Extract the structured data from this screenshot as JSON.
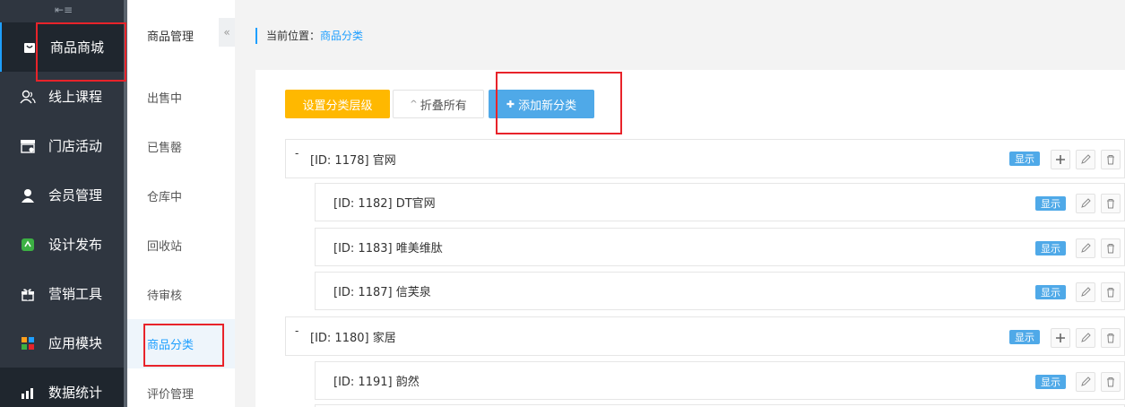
{
  "nav": {
    "collapse_glyph": "⇤≡",
    "items": [
      {
        "label": "商品商城",
        "icon": "bag-icon"
      },
      {
        "label": "线上课程",
        "icon": "user-group-icon"
      },
      {
        "label": "门店活动",
        "icon": "store-icon"
      },
      {
        "label": "会员管理",
        "icon": "user-icon"
      },
      {
        "label": "设计发布",
        "icon": "design-icon"
      },
      {
        "label": "营销工具",
        "icon": "gift-icon"
      },
      {
        "label": "应用模块",
        "icon": "apps-icon"
      },
      {
        "label": "数据统计",
        "icon": "stats-icon"
      }
    ]
  },
  "submenu": {
    "title": "商品管理",
    "items": [
      "出售中",
      "已售罄",
      "仓库中",
      "回收站",
      "待审核",
      "商品分类",
      "评价管理"
    ],
    "toggle_glyph": "«"
  },
  "breadcrumb": {
    "prefix": "当前位置：",
    "current": "商品分类"
  },
  "toolbar": {
    "set_level": "设置分类层级",
    "collapse_all": "折叠所有",
    "collapse_glyph": "^",
    "add_new": "添加新分类",
    "add_glyph": "✚"
  },
  "categories": [
    {
      "label": "[ID: 1178] 官网",
      "badge": "显示",
      "level": 0
    },
    {
      "label": "[ID: 1182] DT官网",
      "badge": "显示",
      "level": 1
    },
    {
      "label": "[ID: 1183] 唯美维肽",
      "badge": "显示",
      "level": 1
    },
    {
      "label": "[ID: 1187] 信芙泉",
      "badge": "显示",
      "level": 1
    },
    {
      "label": "[ID: 1180] 家居",
      "badge": "显示",
      "level": 0
    },
    {
      "label": "[ID: 1191] 韵然",
      "badge": "显示",
      "level": 1
    }
  ],
  "colors": {
    "accent": "#1e9fff",
    "highlight": "#e8232a",
    "warning": "#ffb800",
    "badge": "#4fa9e8",
    "sidebar": "#2f3640"
  }
}
